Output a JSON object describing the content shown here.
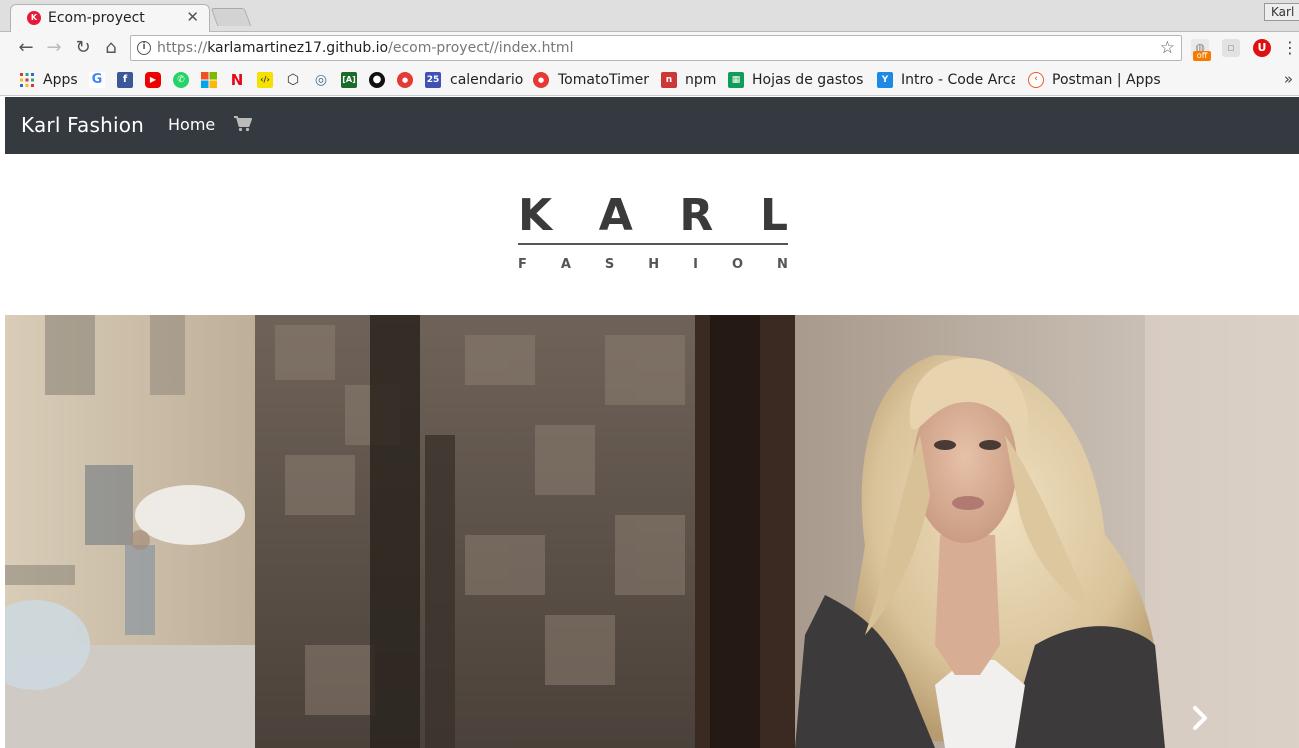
{
  "browser": {
    "tab_title": "Ecom-proyect",
    "tab_favicon_letter": "K",
    "profile_name": "Karl",
    "url_scheme": "https://",
    "url_host": "karlamartinez17.github.io",
    "url_path": "/ecom-proyect//index.html",
    "extension_badge": "off"
  },
  "bookmarks": {
    "apps_label": "Apps",
    "items": [
      {
        "label": "calendario",
        "icon": "calendar-icon",
        "badge": "25"
      },
      {
        "label": "TomatoTimer",
        "icon": "tomato-icon"
      },
      {
        "label": "npm",
        "icon": "npm-icon"
      },
      {
        "label": "Hojas de gastos",
        "icon": "sheets-icon"
      },
      {
        "label": "Intro - Code Arca",
        "icon": "codearcade-icon"
      },
      {
        "label": "Postman | Apps",
        "icon": "postman-icon"
      }
    ]
  },
  "site": {
    "brand": "Karl Fashion",
    "nav_home": "Home",
    "logo_main": [
      "K",
      "A",
      "R",
      "L"
    ],
    "logo_sub": [
      "F",
      "A",
      "S",
      "H",
      "I",
      "O",
      "N"
    ]
  },
  "colors": {
    "navbar": "#343a40",
    "accent_favicon": "#e8193c"
  }
}
